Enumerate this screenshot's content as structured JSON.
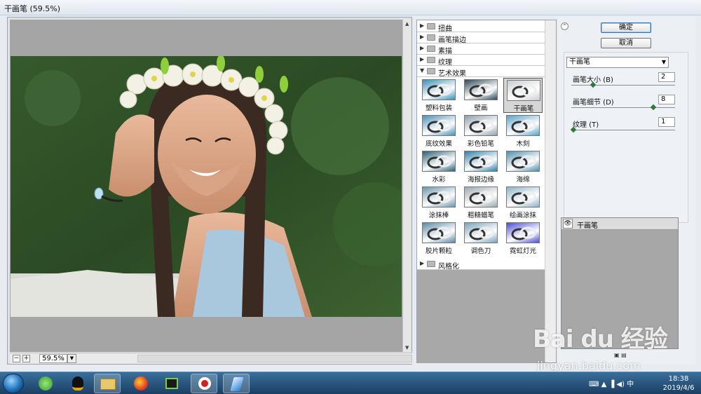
{
  "window": {
    "title": "干画笔 (59.5%)"
  },
  "preview": {
    "zoom": "59.5%",
    "zoom_out": "−",
    "zoom_in": "+"
  },
  "filters": {
    "categories_top": [
      {
        "id": "distort",
        "label": "扭曲",
        "expanded": false
      },
      {
        "id": "brush-strokes",
        "label": "画笔描边",
        "expanded": false
      },
      {
        "id": "sketch",
        "label": "素描",
        "expanded": false
      },
      {
        "id": "texture",
        "label": "纹理",
        "expanded": false
      },
      {
        "id": "artistic",
        "label": "艺术效果",
        "expanded": true
      }
    ],
    "artistic_items": [
      {
        "label": "塑料包装",
        "color": "#3b8fb7"
      },
      {
        "label": "壁画",
        "color": "#2d4a5a"
      },
      {
        "label": "干画笔",
        "color": "#c8ced2",
        "selected": true
      },
      {
        "label": "底纹效果",
        "color": "#4a8fb8"
      },
      {
        "label": "彩色铅笔",
        "color": "#8fa0ad"
      },
      {
        "label": "木刻",
        "color": "#5aa2c6"
      },
      {
        "label": "水彩",
        "color": "#2a5f74"
      },
      {
        "label": "海报边缘",
        "color": "#2f7fa8"
      },
      {
        "label": "海绵",
        "color": "#4f8fad"
      },
      {
        "label": "涂抹棒",
        "color": "#6d95ab"
      },
      {
        "label": "粗糙蜡笔",
        "color": "#9aa9b3"
      },
      {
        "label": "绘画涂抹",
        "color": "#8fb3c8"
      },
      {
        "label": "胶片颗粒",
        "color": "#5b8aa5"
      },
      {
        "label": "调色刀",
        "color": "#7aa3bb"
      },
      {
        "label": "霓虹灯光",
        "color": "#4a4fd0"
      }
    ],
    "categories_bottom": [
      {
        "id": "stylize",
        "label": "风格化",
        "expanded": false
      }
    ]
  },
  "buttons": {
    "ok": "确定",
    "cancel": "取消"
  },
  "settings": {
    "filter_select": "干画笔",
    "params": [
      {
        "label": "画笔大小 (B)",
        "value": "2",
        "fraction": 0.2
      },
      {
        "label": "画笔细节 (D)",
        "value": "8",
        "fraction": 0.8
      },
      {
        "label": "纹理 (T)",
        "value": "1",
        "fraction": 0.0
      }
    ]
  },
  "layers": {
    "items": [
      {
        "name": "干画笔"
      }
    ]
  },
  "watermark": {
    "brand": "Bai du 经验",
    "url": "jingyan.baidu.com"
  },
  "taskbar": {
    "time": "18:38",
    "date": "2019/4/6"
  }
}
